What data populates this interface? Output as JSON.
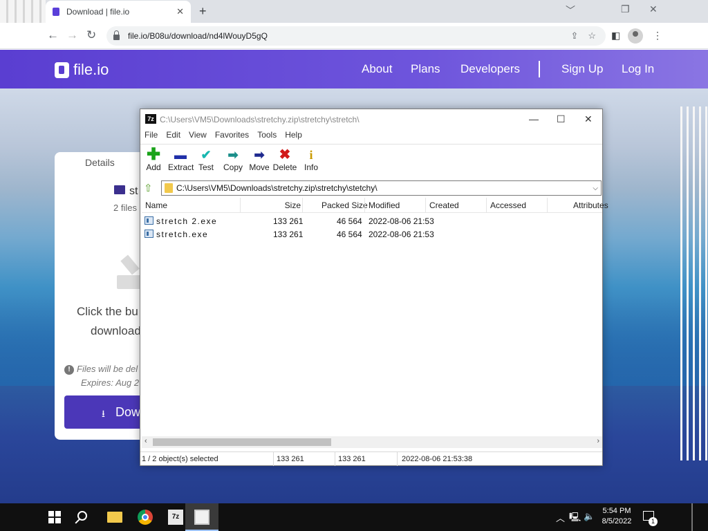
{
  "browser": {
    "tab_title": "Download | file.io",
    "tab_close": "✕",
    "new_tab": "+",
    "url": "file.io/B08u/download/nd4lWouyD5gQ",
    "window_controls": {
      "minimize": "﹀",
      "restore": "❐",
      "close": "✕"
    }
  },
  "site": {
    "logo": "file.io",
    "nav": [
      "About",
      "Plans",
      "Developers",
      "Sign Up",
      "Log In"
    ],
    "brand_color": "#5a3ed1"
  },
  "card": {
    "tab": "Details",
    "name": "st",
    "files": "2 files",
    "click_line1": "Click the bu",
    "click_line2": "download",
    "warning_line1": "Files will be del",
    "warning_line2": "Expires: Aug 2",
    "download_label": "Dow"
  },
  "zip": {
    "title": "C:\\Users\\VM5\\Downloads\\stretchy.zip\\stretchy\\stretch\\",
    "app_icon": "7z",
    "menu": [
      "File",
      "Edit",
      "View",
      "Favorites",
      "Tools",
      "Help"
    ],
    "tools": [
      {
        "label": "Add",
        "icon": "add-icon"
      },
      {
        "label": "Extract",
        "icon": "extract-icon"
      },
      {
        "label": "Test",
        "icon": "test-icon"
      },
      {
        "label": "Copy",
        "icon": "copy-icon"
      },
      {
        "label": "Move",
        "icon": "move-icon"
      },
      {
        "label": "Delete",
        "icon": "delete-icon"
      },
      {
        "label": "Info",
        "icon": "info-icon"
      }
    ],
    "address": "C:\\Users\\VM5\\Downloads\\stretchy.zip\\stretchy\\stetchy\\",
    "columns": [
      "Name",
      "Size",
      "Packed Size",
      "Modified",
      "Created",
      "Accessed",
      "Attributes"
    ],
    "rows": [
      {
        "name": "stretch 2.exe",
        "size": "133 261",
        "packed": "46 564",
        "modified": "2022-08-06 21:53"
      },
      {
        "name": "stretch.exe",
        "size": "133 261",
        "packed": "46 564",
        "modified": "2022-08-06 21:53"
      }
    ],
    "status": {
      "selected": "1 / 2 object(s) selected",
      "size": "133 261",
      "packed": "133 261",
      "modified": "2022-08-06 21:53:38"
    }
  },
  "taskbar": {
    "time": "5:54 PM",
    "date": "8/5/2022",
    "notification_count": "1",
    "z7_label": "7z"
  }
}
